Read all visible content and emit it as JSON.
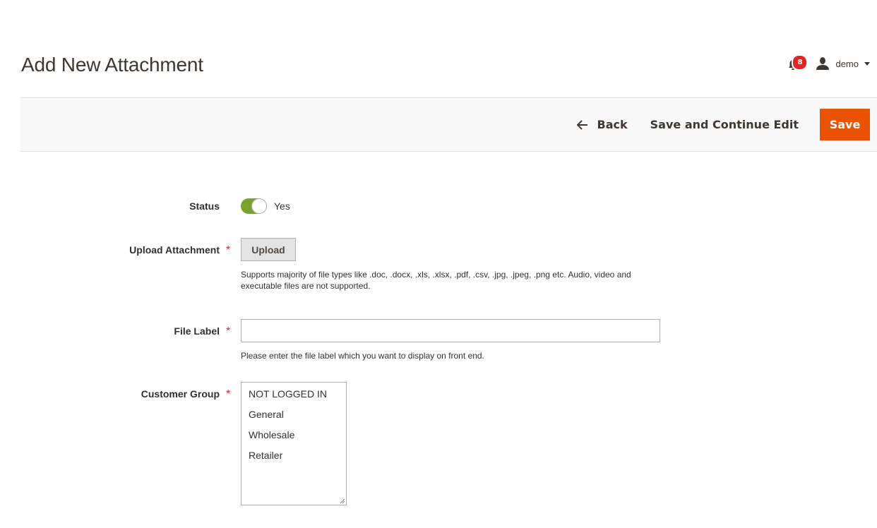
{
  "page": {
    "title": "Add New Attachment"
  },
  "header": {
    "notifications_count": "8",
    "user_name": "demo"
  },
  "actions": {
    "back_label": "Back",
    "save_continue_label": "Save and Continue Edit",
    "save_label": "Save",
    "primary_color": "#eb5202"
  },
  "form": {
    "status": {
      "label": "Status",
      "value_text": "Yes",
      "enabled": true,
      "toggle_color": "#79a22e"
    },
    "upload": {
      "label": "Upload Attachment",
      "required_marker": "*",
      "button_label": "Upload",
      "note_line1": "Supports majority of file types like .doc, .docx, .xls, .xlsx, .pdf, .csv, .jpg, .jpeg, .png etc. Audio, video and",
      "note_line2": "executable files are not supported."
    },
    "file_label": {
      "label": "File Label",
      "required_marker": "*",
      "value": "",
      "note": "Please enter the file label which you want to display on front end."
    },
    "customer_group": {
      "label": "Customer Group",
      "required_marker": "*",
      "options": [
        "NOT LOGGED IN",
        "General",
        "Wholesale",
        "Retailer"
      ]
    }
  }
}
